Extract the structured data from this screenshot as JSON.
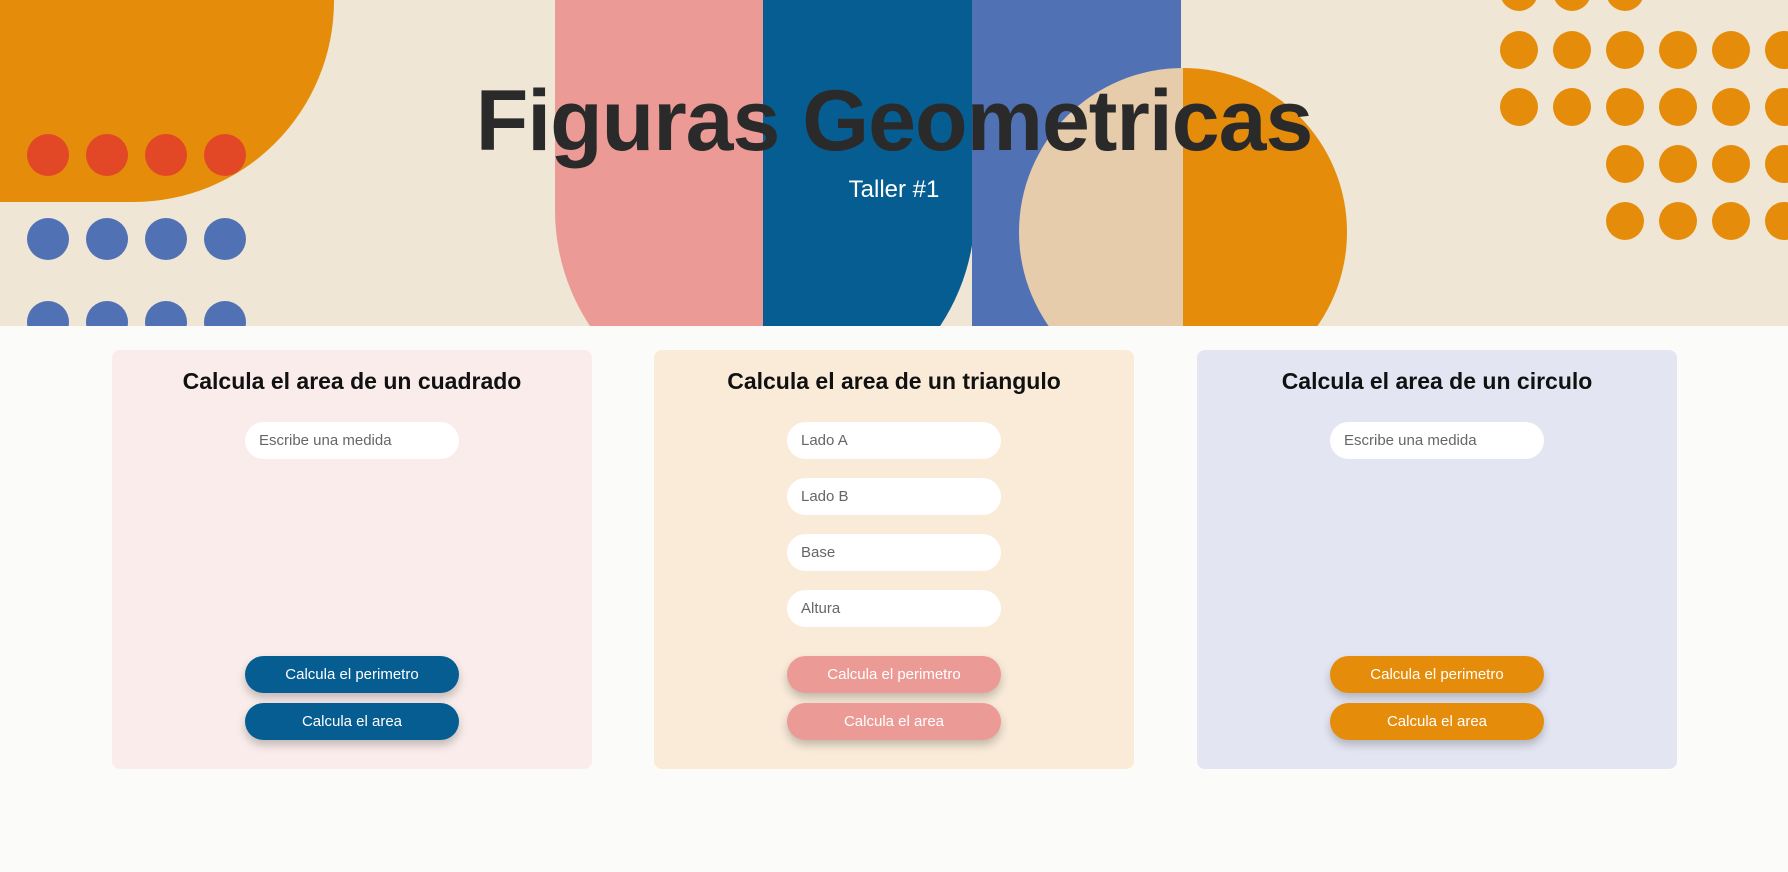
{
  "header": {
    "title": "Figuras Geometricas",
    "subtitle": "Taller #1"
  },
  "cards": [
    {
      "title": "Calcula el area de un cuadrado",
      "background": "#f9ecea",
      "button_color": "#055d91",
      "inputs": [
        {
          "placeholder": "Escribe una medida",
          "value": ""
        }
      ],
      "buttons": {
        "perimeter": "Calcula el perimetro",
        "area": "Calcula el area"
      }
    },
    {
      "title": "Calcula el area de un triangulo",
      "background": "#f9ebd8",
      "button_color": "#ec9a95",
      "inputs": [
        {
          "placeholder": "Lado A",
          "value": ""
        },
        {
          "placeholder": "Lado B",
          "value": ""
        },
        {
          "placeholder": "Base",
          "value": ""
        },
        {
          "placeholder": "Altura",
          "value": ""
        }
      ],
      "buttons": {
        "perimeter": "Calcula el perimetro",
        "area": "Calcula el area"
      }
    },
    {
      "title": "Calcula el area de un circulo",
      "background": "#e3e6f2",
      "button_color": "#e68c0b",
      "inputs": [
        {
          "placeholder": "Escribe una medida",
          "value": ""
        }
      ],
      "buttons": {
        "perimeter": "Calcula el perimetro",
        "area": "Calcula el area"
      }
    }
  ],
  "colors": {
    "hero_bg": "#efe6d5",
    "orange": "#e68c0b",
    "pink": "#ec9a95",
    "navy": "#055d91",
    "blue": "#5071b4",
    "red": "#e34826",
    "sand": "#e6ccab"
  }
}
